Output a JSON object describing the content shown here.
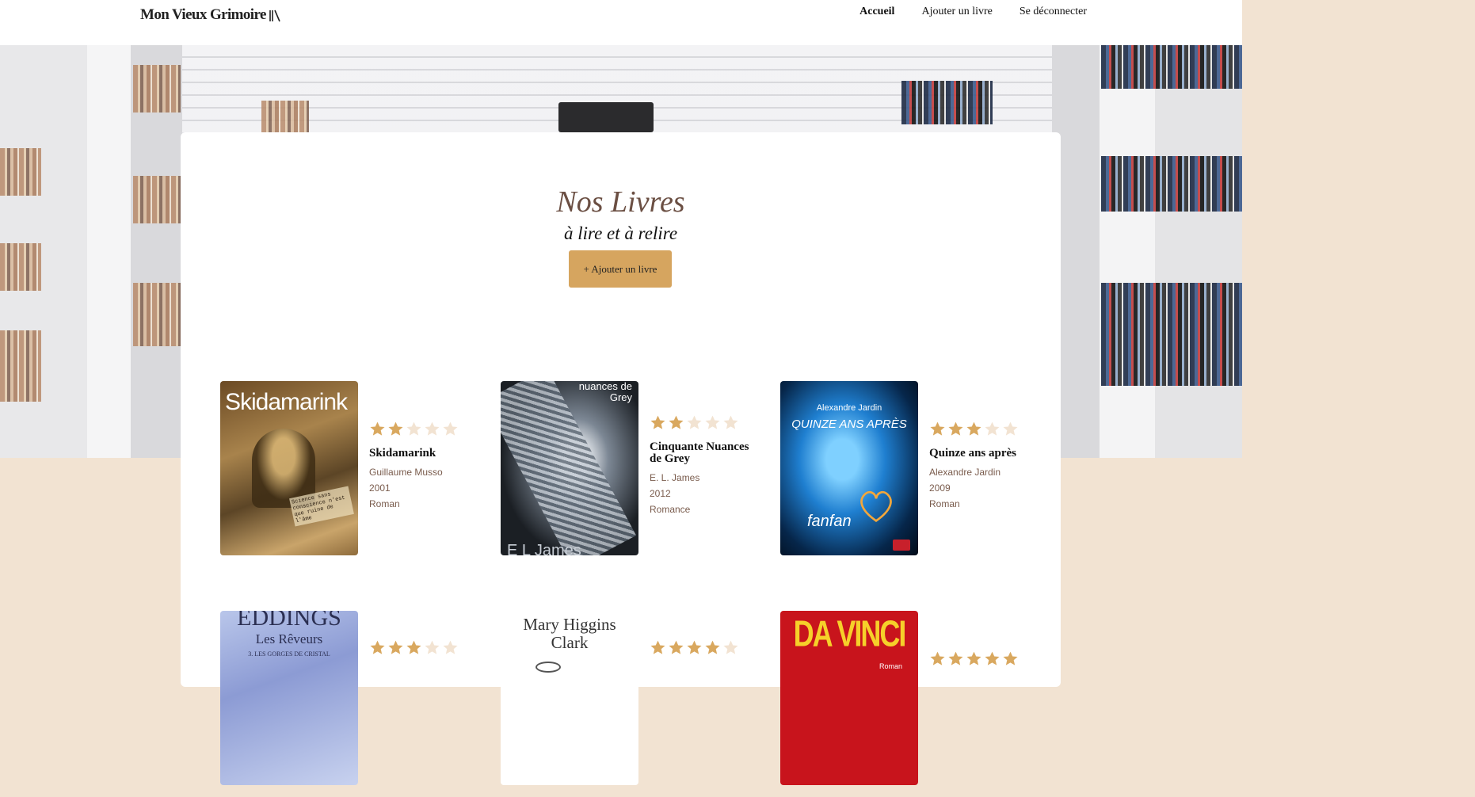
{
  "header": {
    "logo_text": "Mon Vieux Grimoire",
    "logo_icon": "books-stack-icon",
    "nav": [
      {
        "label": "Accueil",
        "active": true
      },
      {
        "label": "Ajouter un livre",
        "active": false
      },
      {
        "label": "Se déconnecter",
        "active": false
      }
    ]
  },
  "main": {
    "title": "Nos Livres",
    "subtitle": "à lire et à relire",
    "add_button": "+ Ajouter un livre"
  },
  "colors": {
    "accent": "#d6a55f",
    "star_filled": "#d9a85f",
    "star_empty": "#f2e3d2",
    "title": "#6b4f43",
    "meta": "#7a5c4d",
    "page_bg": "#f2e3d2"
  },
  "books": [
    {
      "title": "Skidamarink",
      "author": "Guillaume Musso",
      "year": "2001",
      "genre": "Roman",
      "rating": 2,
      "cover_text": "Skidamarink",
      "cover_sub": "Science sans conscience n'est que ruine de l'âme"
    },
    {
      "title": "Cinquante Nuances de Grey",
      "author": "E. L. James",
      "year": "2012",
      "genre": "Romance",
      "rating": 2,
      "cover_text": "nuances de Grey",
      "cover_sub": "E L James"
    },
    {
      "title": "Quinze ans après",
      "author": "Alexandre Jardin",
      "year": "2009",
      "genre": "Roman",
      "rating": 3,
      "cover_text": "Quinze ans après",
      "cover_author": "Alexandre Jardin",
      "cover_sub": "fanfan"
    },
    {
      "title": "",
      "author": "",
      "year": "",
      "genre": "",
      "rating": 3,
      "cover_text": "EDDINGS",
      "cover_sub": "Les Rêveurs",
      "cover_sub2": "3. Les gorges de cristal"
    },
    {
      "title": "",
      "author": "",
      "year": "",
      "genre": "",
      "rating": 4,
      "cover_text": "Mary Higgins Clark"
    },
    {
      "title": "",
      "author": "",
      "year": "",
      "genre": "",
      "rating": 5,
      "cover_text": "DA VINCI",
      "cover_sub": "Roman"
    }
  ]
}
